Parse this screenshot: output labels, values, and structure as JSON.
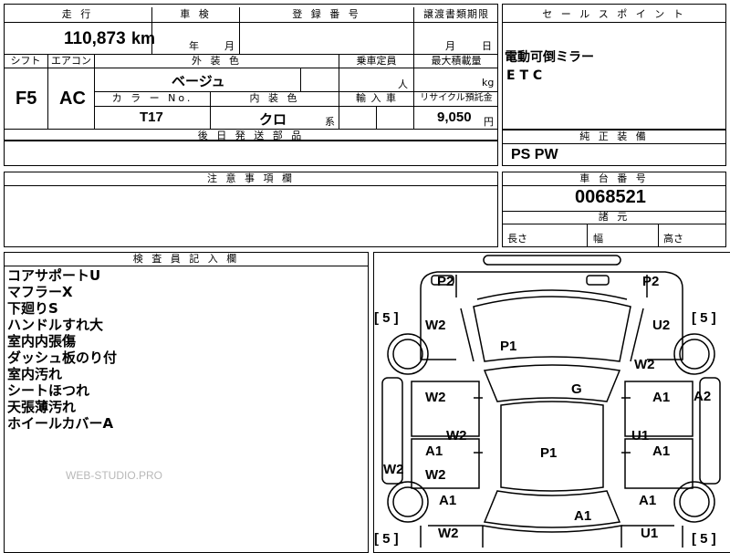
{
  "top": {
    "mileage_label": "走 行",
    "mileage_value": "110,873",
    "mileage_unit": "km",
    "inspection_label": "車 検",
    "year_label": "年",
    "month_label": "月",
    "registration_label": "登 録 番 号",
    "transfer_label": "譲渡書類期限",
    "transfer_month": "月",
    "transfer_day": "日",
    "shift_label": "シフト",
    "shift_value": "F5",
    "aircon_label": "エアコン",
    "aircon_value": "AC",
    "exterior_label": "外 装 色",
    "exterior_value": "ベージュ",
    "seating_label": "乗車定員",
    "seating_unit": "人",
    "max_load_label": "最大積載量",
    "max_load_unit": "kg",
    "color_no_label": "カ ラ ー No.",
    "color_no_value": "T17",
    "interior_label": "内 装 色",
    "interior_value": "クロ",
    "interior_suffix": "系",
    "import_label": "輸 入 車",
    "recycle_label": "リサイクル預託金",
    "recycle_value": "9,050",
    "recycle_unit": "円",
    "later_parts_label": "後 日 発 送 部 品"
  },
  "sales_point": {
    "label": "セ ー ル ス ポ イ ン ト",
    "lines": [
      "電動可倒ミラー",
      "E T C"
    ]
  },
  "standard_equipment": {
    "label": "純 正 装 備",
    "value": "PS PW"
  },
  "caution": {
    "label": "注 意 事 項 欄"
  },
  "chassis": {
    "label": "車 台 番 号",
    "value": "0068521",
    "specs_label": "諸 元",
    "length_label": "長さ",
    "width_label": "幅",
    "height_label": "高さ"
  },
  "inspector": {
    "label": "検 査 員 記 入 欄",
    "notes": [
      "コアサポートU",
      "マフラーX",
      "下廻りS",
      "ハンドルすれ大",
      "室内内張傷",
      "ダッシュ板のり付",
      "室内汚れ",
      "シートほつれ",
      "天張薄汚れ",
      "ホイールカバーA"
    ]
  },
  "watermark": "WEB-STUDIO.PRO",
  "diagram": {
    "marks": [
      "P2",
      "P2",
      "W2",
      "U2",
      "P1",
      "W2",
      "G",
      "W2",
      "A1",
      "A2",
      "W2",
      "U1",
      "A1",
      "P1",
      "A1",
      "W2",
      "W2",
      "A1",
      "A1",
      "A1",
      "W2",
      "U1"
    ],
    "tire_labels": [
      "[ 5 ]",
      "[ 5 ]",
      "[ 5 ]",
      "[ 5 ]"
    ]
  }
}
